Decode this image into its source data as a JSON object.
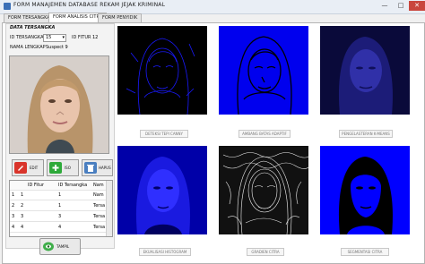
{
  "window": {
    "title": "FORM MANAJEMEN DATABASE REKAM JEJAK KRIMINAL",
    "minimize": "—",
    "maximize": "□",
    "close": "✕"
  },
  "tabs": [
    {
      "label": "FORM TERSANGKA"
    },
    {
      "label": "FORM ANALISIS CITRA"
    },
    {
      "label": "FORM PENYIDIK"
    }
  ],
  "left": {
    "section_title": "DATA TERSANGKA",
    "id_tersangka_label": "ID TERSANGKA",
    "id_tersangka_value": "15",
    "id_fitur_label": "ID FITUR",
    "id_fitur_value": "12",
    "nama_label": "NAMA LENGKAP",
    "nama_value": "Suspect 9",
    "buttons": {
      "edit": "EDIT",
      "add": "ISO",
      "delete": "HAPUS"
    },
    "table": {
      "columns": [
        "ID Fitur",
        "ID Tersangka",
        "Nam"
      ],
      "rows": [
        [
          "1",
          "1",
          "Nam"
        ],
        [
          "2",
          "1",
          "Tersa"
        ],
        [
          "3",
          "3",
          "Tersa"
        ],
        [
          "4",
          "4",
          "Tersa"
        ]
      ]
    },
    "tampil_button": "TAMPIL"
  },
  "captions": {
    "canny": "DETEKSI TEPI CANNY",
    "adaptive": "AMBANG BATAS ADAPTIF",
    "kmeans": "PENGELASTERAN K-MEANS",
    "histogram": "EKUALISASI HISTOGRAM",
    "gradient": "GRADIEN CITRA",
    "segment": "SEGMENTASI CITRA"
  },
  "colors": {
    "blue": "#1a1aff",
    "deep_blue": "#0000c8",
    "black": "#000000"
  }
}
